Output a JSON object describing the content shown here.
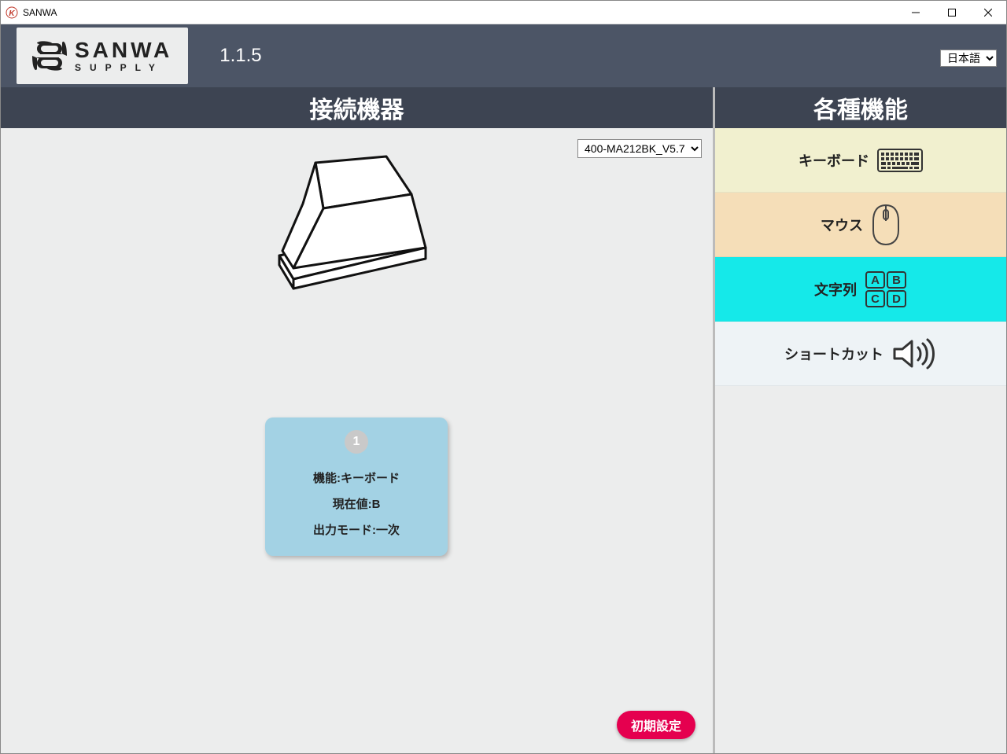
{
  "window": {
    "title": "SANWA"
  },
  "header": {
    "logo_main": "SANWA",
    "logo_sub": "SUPPLY",
    "version": "1.1.5",
    "language": "日本語"
  },
  "sections": {
    "left_title": "接続機器",
    "right_title": "各種機能"
  },
  "device": {
    "selected": "400-MA212BK_V5.7"
  },
  "pedal": {
    "number": "1",
    "line1": "機能:キーボード",
    "line2": "現在値:B",
    "line3": "出力モード:一次"
  },
  "buttons": {
    "reset": "初期設定"
  },
  "functions": {
    "keyboard": "キーボード",
    "mouse": "マウス",
    "string": "文字列",
    "shortcut": "ショートカット"
  }
}
